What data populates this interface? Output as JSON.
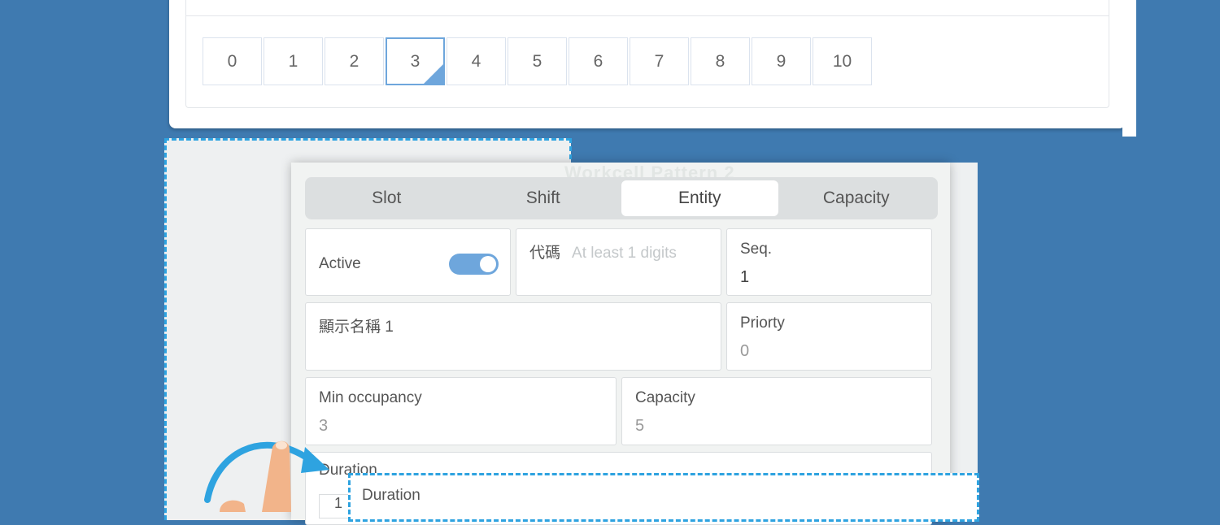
{
  "pagination": {
    "pages": [
      "0",
      "1",
      "2",
      "3",
      "4",
      "5",
      "6",
      "7",
      "8",
      "9",
      "10"
    ],
    "active": "3"
  },
  "dialog": {
    "ghost_title": "Workcell Pattern 2",
    "tabs": [
      {
        "label": "Slot"
      },
      {
        "label": "Shift"
      },
      {
        "label": "Entity",
        "selected": true
      },
      {
        "label": "Capacity"
      }
    ],
    "fields": {
      "active": {
        "label": "Active",
        "on": true
      },
      "code": {
        "label": "代碼",
        "placeholder": "At least 1 digits"
      },
      "seq": {
        "label": "Seq.",
        "value": "1"
      },
      "display_name": {
        "label": "顯示名稱 1"
      },
      "priority": {
        "label": "Priorty",
        "value": "0"
      },
      "min_occupancy": {
        "label": "Min occupancy",
        "value": "3"
      },
      "capacity": {
        "label": "Capacity",
        "value": "5"
      },
      "duration": {
        "label": "Duration",
        "value": "1"
      }
    }
  },
  "popup": {
    "label": "Duration"
  },
  "colors": {
    "accent": "#6ea6dc",
    "dash": "#2ea3e0",
    "background": "#3f7ab0"
  },
  "icons": {
    "gesture": "tap-finger-icon"
  }
}
